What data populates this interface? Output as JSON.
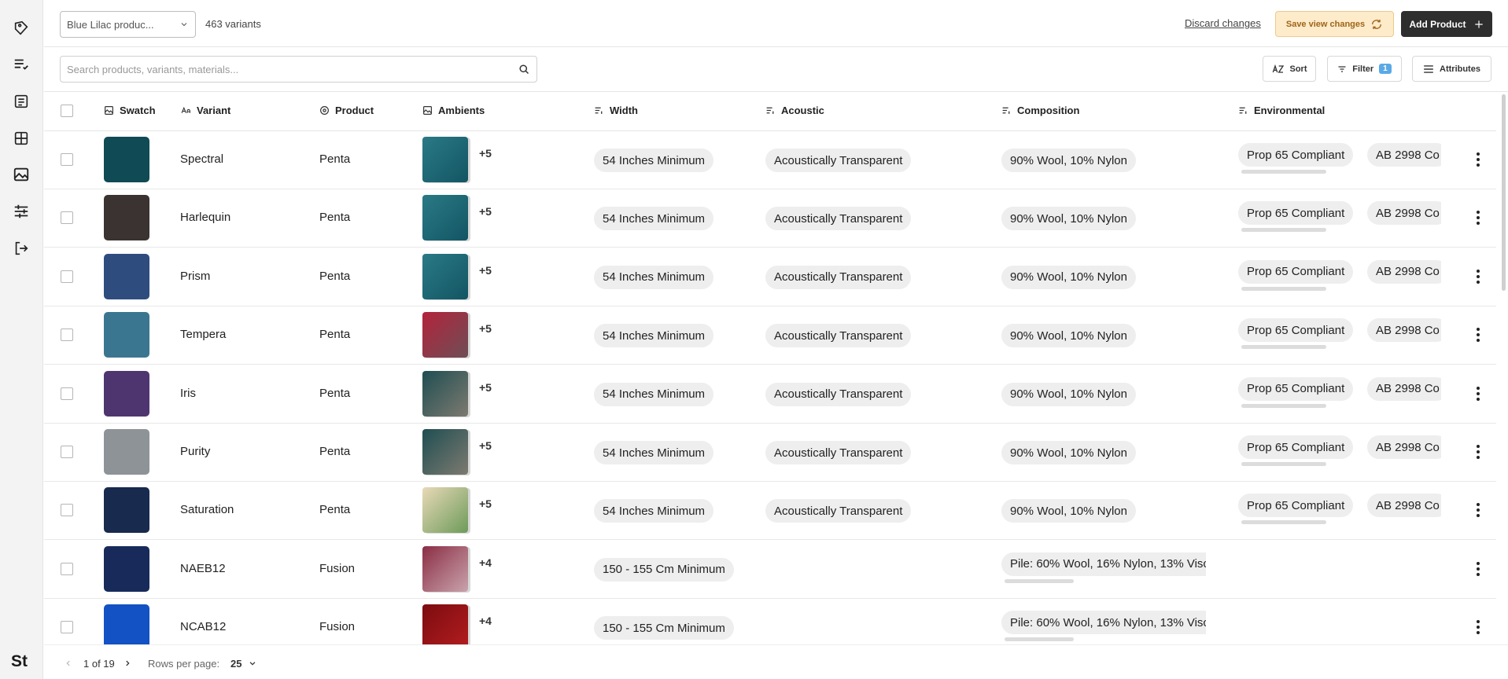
{
  "toolbar": {
    "collection_select": "Blue Lilac produc...",
    "variants_count": "463 variants",
    "discard_label": "Discard changes",
    "save_label": "Save view changes",
    "add_label": "Add Product"
  },
  "search": {
    "placeholder": "Search products, variants, materials..."
  },
  "controls": {
    "sort_label": "Sort",
    "filter_label": "Filter",
    "filter_count": "1",
    "attributes_label": "Attributes"
  },
  "columns": {
    "swatch": "Swatch",
    "variant": "Variant",
    "product": "Product",
    "ambients": "Ambients",
    "width": "Width",
    "acoustic": "Acoustic",
    "composition": "Composition",
    "environmental": "Environmental"
  },
  "rows": [
    {
      "swatch_color": "#0f4a55",
      "variant": "Spectral",
      "product": "Penta",
      "ambient_more": "+5",
      "ambient_colors": [
        "#2a7a86",
        "#135563"
      ],
      "width": "54 Inches Minimum",
      "acoustic": "Acoustically Transparent",
      "composition": "90% Wool, 10% Nylon",
      "env1": "Prop 65 Compliant",
      "env2": "AB 2998 Co"
    },
    {
      "swatch_color": "#3b3331",
      "variant": "Harlequin",
      "product": "Penta",
      "ambient_more": "+5",
      "ambient_colors": [
        "#2a7a86",
        "#135563"
      ],
      "width": "54 Inches Minimum",
      "acoustic": "Acoustically Transparent",
      "composition": "90% Wool, 10% Nylon",
      "env1": "Prop 65 Compliant",
      "env2": "AB 2998 Co"
    },
    {
      "swatch_color": "#2e4c7e",
      "variant": "Prism",
      "product": "Penta",
      "ambient_more": "+5",
      "ambient_colors": [
        "#2a7a86",
        "#135563"
      ],
      "width": "54 Inches Minimum",
      "acoustic": "Acoustically Transparent",
      "composition": "90% Wool, 10% Nylon",
      "env1": "Prop 65 Compliant",
      "env2": "AB 2998 Co"
    },
    {
      "swatch_color": "#3b7690",
      "variant": "Tempera",
      "product": "Penta",
      "ambient_more": "+5",
      "ambient_colors": [
        "#b3233b",
        "#6e4e56"
      ],
      "width": "54 Inches Minimum",
      "acoustic": "Acoustically Transparent",
      "composition": "90% Wool, 10% Nylon",
      "env1": "Prop 65 Compliant",
      "env2": "AB 2998 Co"
    },
    {
      "swatch_color": "#4f3570",
      "variant": "Iris",
      "product": "Penta",
      "ambient_more": "+5",
      "ambient_colors": [
        "#1f4e52",
        "#7d7a70"
      ],
      "width": "54 Inches Minimum",
      "acoustic": "Acoustically Transparent",
      "composition": "90% Wool, 10% Nylon",
      "env1": "Prop 65 Compliant",
      "env2": "AB 2998 Co"
    },
    {
      "swatch_color": "#8e9398",
      "variant": "Purity",
      "product": "Penta",
      "ambient_more": "+5",
      "ambient_colors": [
        "#1f4e52",
        "#7d7a70"
      ],
      "width": "54 Inches Minimum",
      "acoustic": "Acoustically Transparent",
      "composition": "90% Wool, 10% Nylon",
      "env1": "Prop 65 Compliant",
      "env2": "AB 2998 Co"
    },
    {
      "swatch_color": "#182a4e",
      "variant": "Saturation",
      "product": "Penta",
      "ambient_more": "+5",
      "ambient_colors": [
        "#e8d9b7",
        "#6d9b5a"
      ],
      "width": "54 Inches Minimum",
      "acoustic": "Acoustically Transparent",
      "composition": "90% Wool, 10% Nylon",
      "env1": "Prop 65 Compliant",
      "env2": "AB 2998 Co"
    },
    {
      "swatch_color": "#172a5a",
      "variant": "NAEB12",
      "product": "Fusion",
      "ambient_more": "+4",
      "ambient_colors": [
        "#8b2e44",
        "#c9a3ad"
      ],
      "width": "150 - 155 Cm Minimum",
      "acoustic": "",
      "composition": "Pile: 60% Wool, 16% Nylon, 13% Visc",
      "env1": "",
      "env2": ""
    },
    {
      "swatch_color": "#1252c4",
      "variant": "NCAB12",
      "product": "Fusion",
      "ambient_more": "+4",
      "ambient_colors": [
        "#7c0c10",
        "#b31d1f"
      ],
      "width": "150 - 155 Cm Minimum",
      "acoustic": "",
      "composition": "Pile: 60% Wool, 16% Nylon, 13% Visc",
      "env1": "",
      "env2": ""
    }
  ],
  "pagination": {
    "page_label": "1 of 19",
    "rows_label": "Rows per page:",
    "rows_value": "25"
  },
  "brand": {
    "logo": "St"
  }
}
